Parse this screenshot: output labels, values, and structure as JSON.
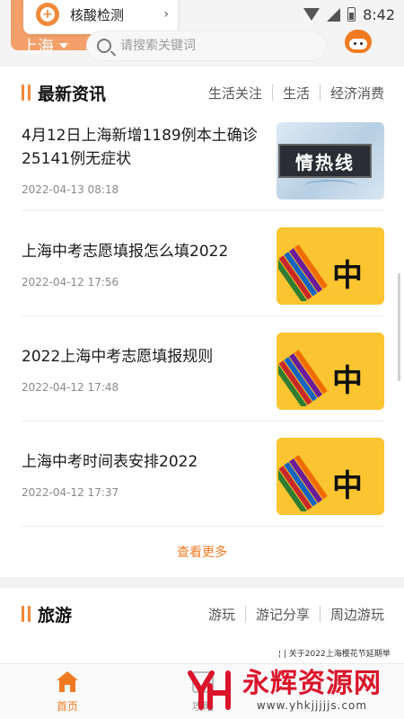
{
  "status_bar": {
    "time": "8:42"
  },
  "popup": {
    "label": "核酸检测",
    "arrow": "›"
  },
  "header": {
    "city": "上海",
    "search_placeholder": "请搜索关键词"
  },
  "news": {
    "title": "最新资讯",
    "categories": [
      "生活关注",
      "生活",
      "经济消费"
    ],
    "items": [
      {
        "title": "4月12日上海新增1189例本土确诊25141例无症状",
        "date": "2022-04-13 08:18",
        "thumb_text": "情热线"
      },
      {
        "title": "上海中考志愿填报怎么填2022",
        "date": "2022-04-12 17:56",
        "thumb_text": "中"
      },
      {
        "title": "2022上海中考志愿填报规则",
        "date": "2022-04-12 17:48",
        "thumb_text": "中"
      },
      {
        "title": "上海中考时间表安排2022",
        "date": "2022-04-12 17:37",
        "thumb_text": "中"
      }
    ],
    "more": "查看更多"
  },
  "travel": {
    "title": "旅游",
    "categories": [
      "游玩",
      "游记分享",
      "周边游玩"
    ],
    "snippet": "¦ | 关于2022上海樱花节延期举"
  },
  "bottom_nav": {
    "home": "首页",
    "guide": "攻略"
  },
  "watermark": {
    "brand": "永辉资源网",
    "url": "www.yhkjjjjjs.com"
  },
  "colors": {
    "accent": "#f07a22",
    "watermark_red": "#d9142b"
  }
}
